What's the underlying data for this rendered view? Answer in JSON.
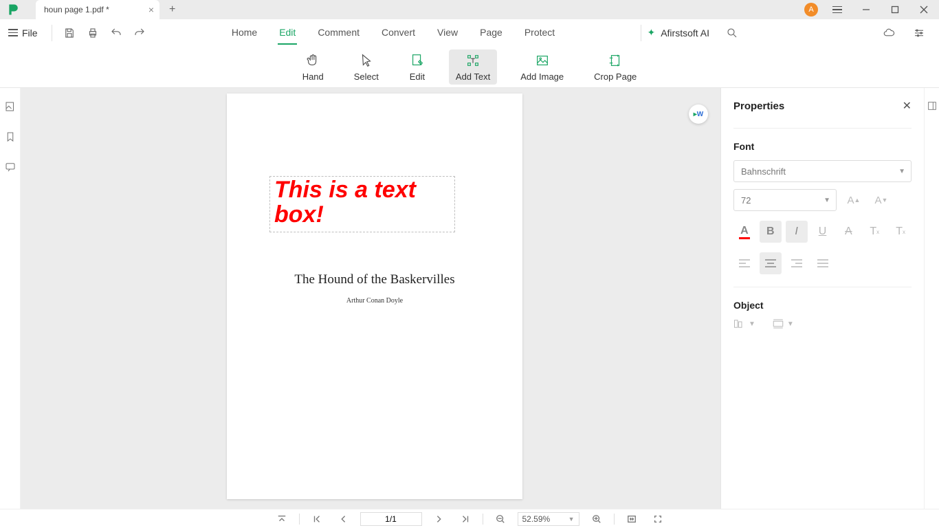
{
  "titlebar": {
    "tab_name": "houn page 1.pdf *",
    "user_initial": "A"
  },
  "menubar": {
    "file_label": "File",
    "tabs": [
      "Home",
      "Edit",
      "Comment",
      "Convert",
      "View",
      "Page",
      "Protect"
    ],
    "active_tab_index": 1,
    "ai_label": "Afirstsoft AI"
  },
  "toolbar": {
    "items": [
      {
        "label": "Hand"
      },
      {
        "label": "Select"
      },
      {
        "label": "Edit"
      },
      {
        "label": "Add Text"
      },
      {
        "label": "Add Image"
      },
      {
        "label": "Crop Page"
      }
    ],
    "active_index": 3
  },
  "document": {
    "textbox_content": "This is a text box!",
    "title": "The Hound of the Baskervilles",
    "author": "Arthur Conan Doyle"
  },
  "properties": {
    "panel_title": "Properties",
    "font_section": "Font",
    "font_name": "Bahnschrift",
    "font_size": "72",
    "object_section": "Object"
  },
  "statusbar": {
    "page": "1/1",
    "zoom": "52.59%"
  }
}
